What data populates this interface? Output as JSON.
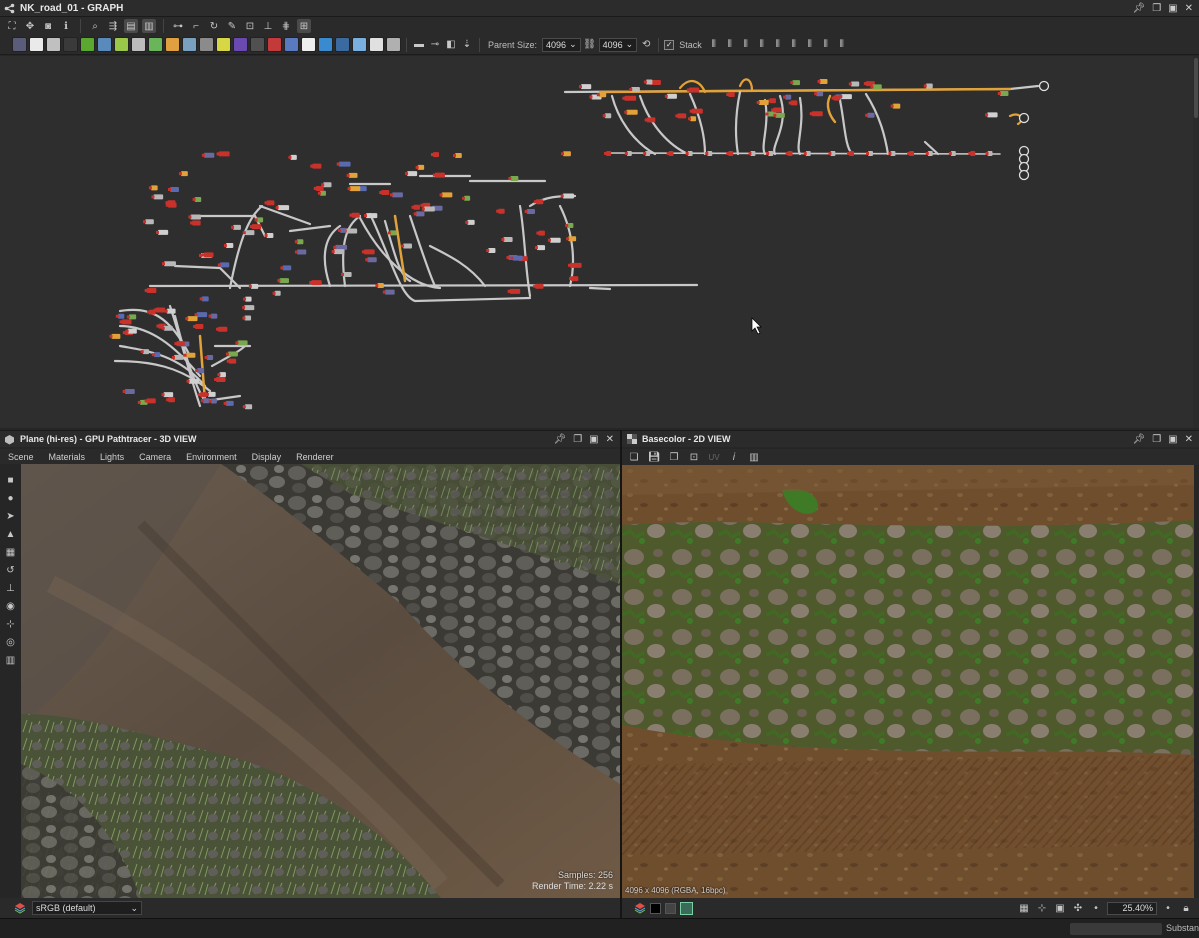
{
  "graph_window": {
    "title": "NK_road_01 - GRAPH",
    "parent_size_label": "Parent Size:",
    "parent_size_value": "4096",
    "size_value": "4096",
    "stack_label": "Stack",
    "node_colors": [
      "#5b5b7a",
      "#eaeaea",
      "#c0c0c0",
      "#3a3a3a",
      "#5aa830",
      "#5a8abb",
      "#9ac64a",
      "#bcbcbc",
      "#6ab45a",
      "#e0a040",
      "#7aa0c0",
      "#8b8b8b",
      "#d7d745",
      "#6a4ab0",
      "#505050",
      "#c23a3a",
      "#5a7ac0",
      "#eeeeee",
      "#3a8ad0",
      "#3a6aa0",
      "#7ab0e0",
      "#e0e0e0",
      "#b0b0b0"
    ]
  },
  "view3d": {
    "title": "Plane (hi-res) - GPU Pathtracer - 3D VIEW",
    "menu": [
      "Scene",
      "Materials",
      "Lights",
      "Camera",
      "Environment",
      "Display",
      "Renderer"
    ],
    "samples": "Samples: 256",
    "render_time": "Render Time: 2.22 s",
    "color_space": "sRGB (default)"
  },
  "view2d": {
    "title": "Basecolor - 2D VIEW",
    "uv_label": "UV",
    "info": "4096 x 4096 (RGBA, 16bpc)",
    "zoom": "25.40%"
  },
  "status": {
    "text": "Substanc"
  }
}
